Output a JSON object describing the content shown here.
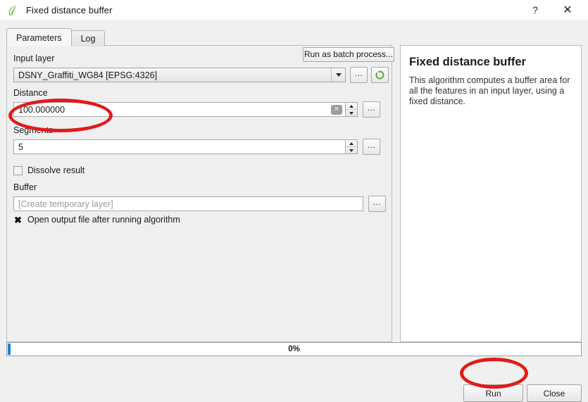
{
  "window": {
    "title": "Fixed distance buffer",
    "icon": "qgis-leaf-icon",
    "help_label": "?",
    "close_label": "✕"
  },
  "tabs": [
    {
      "label": "Parameters",
      "active": true
    },
    {
      "label": "Log",
      "active": false
    }
  ],
  "toolbar": {
    "batch_label": "Run as batch process..."
  },
  "fields": {
    "input_layer": {
      "label": "Input layer",
      "value": "DSNY_Graffiti_WG84 [EPSG:4326]",
      "browse_label": "...",
      "iterate_icon": "refresh-icon"
    },
    "distance": {
      "label": "Distance",
      "value": "100.000000",
      "clear_label": "✕",
      "browse_label": "..."
    },
    "segments": {
      "label": "Segments",
      "value": "5",
      "browse_label": "..."
    },
    "dissolve": {
      "label": "Dissolve result",
      "checked": false
    },
    "buffer": {
      "label": "Buffer",
      "placeholder": "[Create temporary layer]",
      "value": "",
      "browse_label": "..."
    },
    "open_output": {
      "label": "Open output file after running algorithm",
      "checked": true,
      "mark": "✖"
    }
  },
  "help": {
    "title": "Fixed distance buffer",
    "description": "This algorithm computes a buffer area for all the features in an input layer, using a fixed distance."
  },
  "progress": {
    "percent_label": "0%",
    "percent_value": 0
  },
  "footer": {
    "run_label": "Run",
    "close_label": "Close"
  },
  "annotations": {
    "accent_color": "#e01b1b",
    "highlighted": [
      "distance-field",
      "run-button"
    ]
  },
  "colors": {
    "dialog_background": "#f0f0f0",
    "panel_background": "#efefef",
    "field_background": "#ffffff",
    "progress_fill": "#1f7fd4",
    "icon_green": "#4a9b3c"
  }
}
